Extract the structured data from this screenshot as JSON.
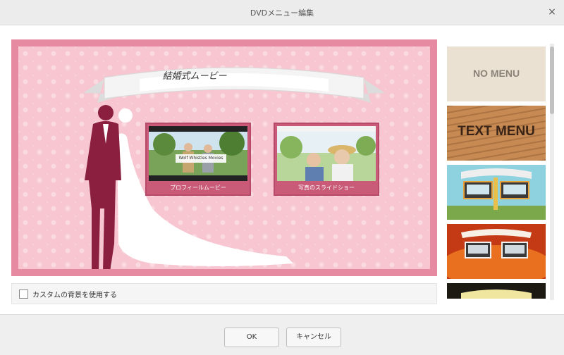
{
  "window": {
    "title": "DVDメニュー編集",
    "close_glyph": "×"
  },
  "preview": {
    "banner_title": "結婚式ムービー",
    "thumbnails": [
      {
        "label": "プロフィールムービー",
        "overlay_text": "Wolf Whistles Movies"
      },
      {
        "label": "写真のスライドショー"
      }
    ]
  },
  "custom_background": {
    "label": "カスタムの背景を使用する",
    "checked": false
  },
  "templates": [
    {
      "title": "NO MENU"
    },
    {
      "title": "TEXT MENU"
    },
    {
      "title": ""
    },
    {
      "title": ""
    },
    {
      "title": ""
    }
  ],
  "buttons": {
    "ok": "OK",
    "cancel": "キャンセル"
  },
  "colors": {
    "frame": "#e58aa0",
    "pattern": "#f7c6d0",
    "thumb": "#c95a78",
    "groom": "#8a1f3f"
  }
}
